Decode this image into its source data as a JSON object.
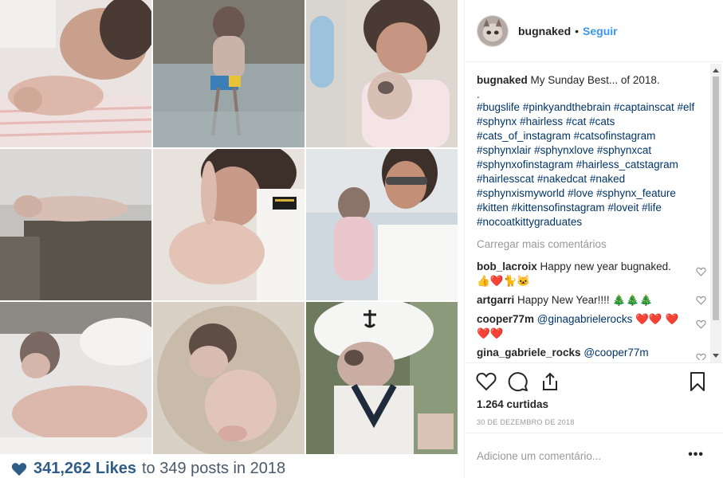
{
  "post": {
    "username": "bugnaked",
    "separator": "•",
    "follow_label": "Seguir",
    "caption_text": "My Sunday Best... of 2018.",
    "caption_dot": ".",
    "hashtags": [
      "#bugslife",
      "#pinkyandthebrain",
      "#captainscat",
      "#elf",
      "#sphynx",
      "#hairless",
      "#cat",
      "#cats",
      "#cats_of_instagram",
      "#catsofinstagram",
      "#sphynxlair",
      "#sphynxlove",
      "#sphynxcat",
      "#sphynxofinstagram",
      "#hairless_catstagram",
      "#hairlesscat",
      "#nakedcat",
      "#naked",
      "#sphynxismyworld",
      "#love",
      "#sphynx_feature",
      "#kitten",
      "#kittensofinstagram",
      "#loveit",
      "#life",
      "#nocoatkittygraduates"
    ],
    "load_more_label": "Carregar mais comentários",
    "comments": [
      {
        "user": "bob_lacroix",
        "text": "Happy new year bugnaked. 👍❤️🐈🐱"
      },
      {
        "user": "artgarri",
        "text": "Happy New Year!!!! 🎄🎄🎄"
      },
      {
        "user": "cooper77m",
        "mention": "@ginagabrielerocks",
        "text": "❤️❤️ ❤️❤️❤️"
      },
      {
        "user": "gina_gabriele_rocks",
        "mention": "@cooper77m",
        "text": ""
      }
    ],
    "likes_label": "1.264 curtidas",
    "date_label": "30 DE DEZEMBRO DE 2018",
    "comment_placeholder": "Adicione um comentário...",
    "more_label": "•••"
  },
  "image_overlay": {
    "likes_count": "341,262 Likes",
    "likes_suffix": "to 349 posts in 2018"
  },
  "icons": {
    "like": "heart-icon",
    "comment": "comment-bubble-icon",
    "share": "share-icon",
    "save": "bookmark-icon"
  },
  "colors": {
    "link": "#3897f0",
    "hashtag": "#003569",
    "muted": "#999999",
    "likes_heart": "#2f5d87"
  }
}
